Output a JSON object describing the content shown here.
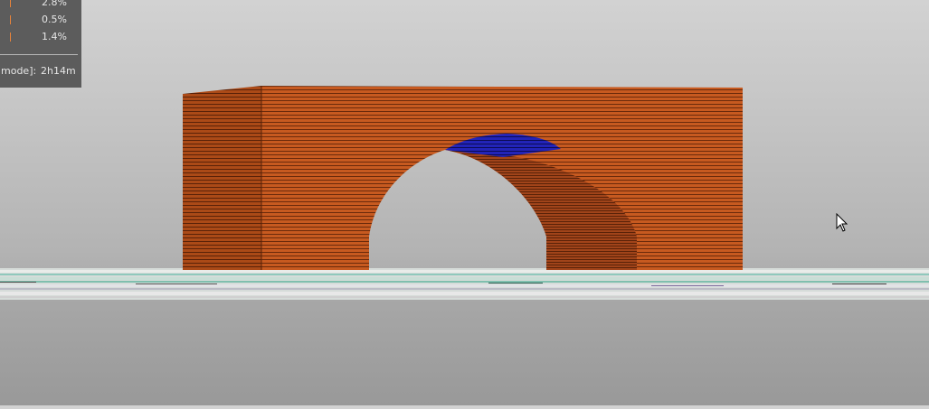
{
  "legend": {
    "rows": [
      {
        "value": "2.8%"
      },
      {
        "value": "0.5%"
      },
      {
        "value": "1.4%"
      }
    ],
    "estimate_label": "mode]:",
    "estimate_value": "2h14m"
  },
  "colors": {
    "model": "#c4571e",
    "model_side": "#a8481a",
    "overhang": "#1d1fa8",
    "bed_base": "#e1e8e4",
    "bed_accent": "#86c2b2",
    "legend_swatch": "#e8833a"
  }
}
